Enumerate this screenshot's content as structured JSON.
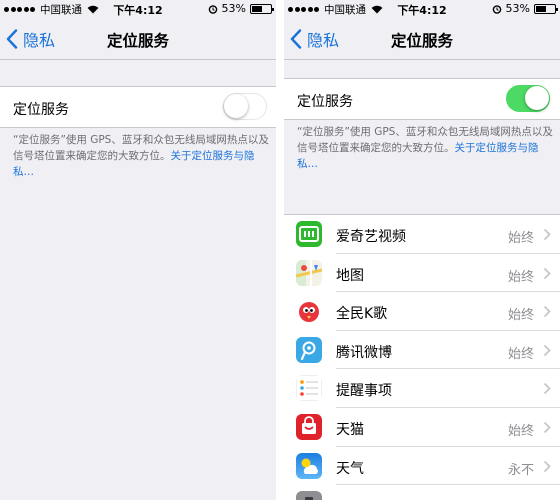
{
  "status_bar": {
    "carrier": "中国联通",
    "time": "下午4:12",
    "battery": "53%",
    "battery_level": 0.53
  },
  "nav": {
    "back_label": "隐私",
    "title": "定位服务"
  },
  "left": {
    "toggle_label": "定位服务",
    "toggle_on": false,
    "desc_text": "“定位服务”使用 GPS、蓝牙和众包无线局域网热点以及信号塔位置来确定您的大致方位。",
    "desc_link": "关于定位服务与隐私…"
  },
  "right": {
    "toggle_label": "定位服务",
    "toggle_on": true,
    "desc_text": "“定位服务”使用 GPS、蓝牙和众包无线局域网热点以及信号塔位置来确定您的大致方位。",
    "desc_link": "关于定位服务与隐私…",
    "apps": [
      {
        "name": "爱奇艺视频",
        "value": "始终",
        "icon": "iqiyi-icon"
      },
      {
        "name": "地图",
        "value": "始终",
        "icon": "maps-icon"
      },
      {
        "name": "全民K歌",
        "value": "始终",
        "icon": "kge-icon"
      },
      {
        "name": "腾讯微博",
        "value": "始终",
        "icon": "tencent-weibo-icon"
      },
      {
        "name": "提醒事项",
        "value": "",
        "icon": "reminders-icon"
      },
      {
        "name": "天猫",
        "value": "始终",
        "icon": "tmall-icon"
      },
      {
        "name": "天气",
        "value": "永不",
        "icon": "weather-icon"
      },
      {
        "name": "",
        "value": "",
        "icon": "camera-icon"
      }
    ]
  },
  "colors": {
    "accent": "#1a73d9",
    "toggle_on": "#4cd964",
    "background": "#efeff4"
  }
}
